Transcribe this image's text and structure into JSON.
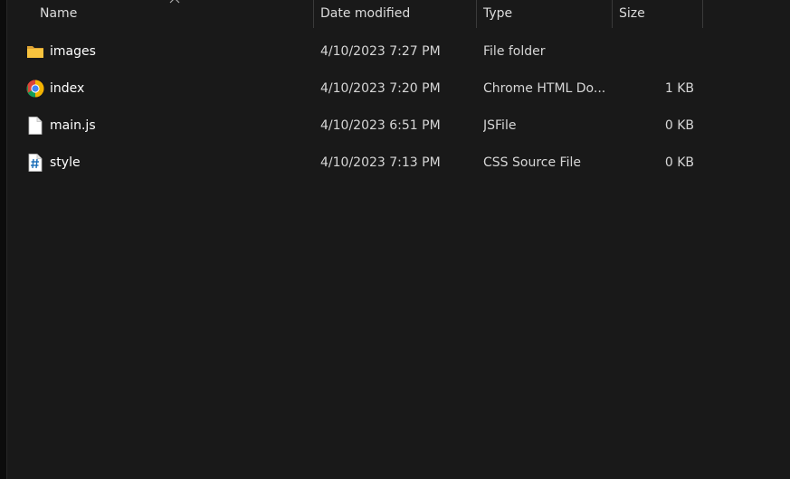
{
  "columns": {
    "name": "Name",
    "date_modified": "Date modified",
    "type": "Type",
    "size": "Size"
  },
  "files": [
    {
      "name": "images",
      "date": "4/10/2023 7:27 PM",
      "type": "File folder",
      "size": "",
      "icon": "folder-icon"
    },
    {
      "name": "index",
      "date": "4/10/2023 7:20 PM",
      "type": "Chrome HTML Do...",
      "size": "1 KB",
      "icon": "chrome-icon"
    },
    {
      "name": "main.js",
      "date": "4/10/2023 6:51 PM",
      "type": "JSFile",
      "size": "0 KB",
      "icon": "file-icon"
    },
    {
      "name": "style",
      "date": "4/10/2023 7:13 PM",
      "type": "CSS Source File",
      "size": "0 KB",
      "icon": "css-file-icon"
    }
  ],
  "colors": {
    "background": "#191919",
    "text": "#ffffff",
    "folder": "#f8c33e",
    "separator": "#3a3a3a"
  }
}
